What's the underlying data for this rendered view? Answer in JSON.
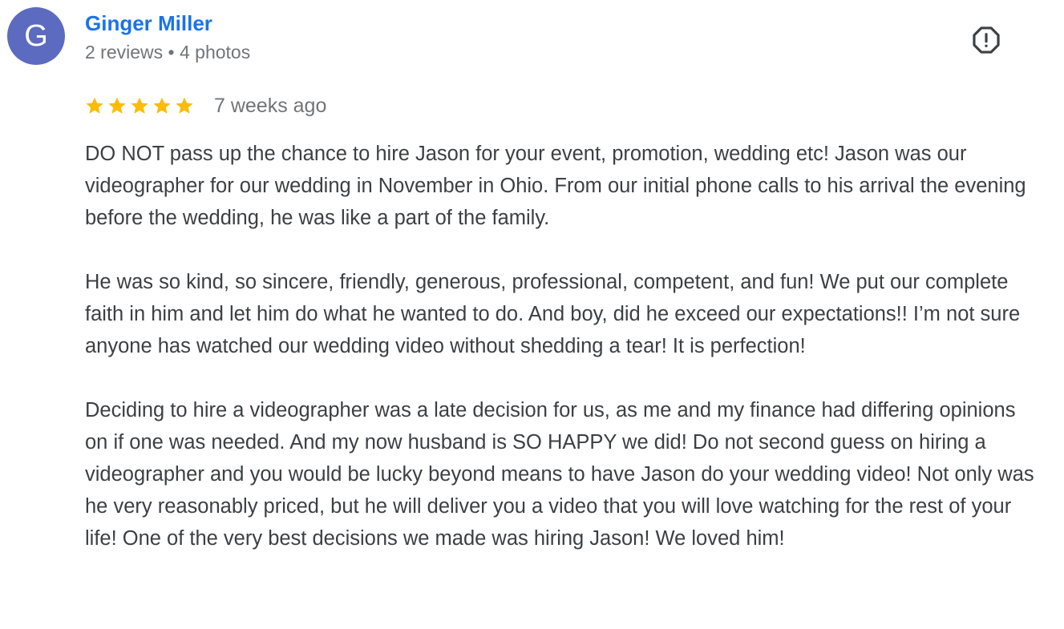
{
  "reviewer": {
    "avatar_letter": "G",
    "avatar_color": "#5c6bc0",
    "name": "Ginger Miller",
    "name_color": "#1a73e8",
    "meta": "2 reviews • 4 photos"
  },
  "report_icon": "report-flag-icon",
  "review": {
    "rating": 5,
    "max_rating": 5,
    "star_color": "#fbbc04",
    "date": "7 weeks ago",
    "paragraphs": [
      "DO NOT pass up the chance to hire Jason for your event, promotion, wedding etc! Jason was our videographer for our wedding in November in Ohio. From our initial phone calls to his arrival the evening before the wedding, he was like a part of the family.",
      "He was so kind, so sincere, friendly, generous, professional, competent, and fun! We put our complete faith in him and let him do what he wanted to do. And boy, did he exceed our expectations!! I’m not sure anyone has watched our wedding video without shedding a tear! It is perfection!",
      "Deciding to hire a videographer was a late decision for us, as me and my finance had differing opinions on if one was needed. And my now husband is SO HAPPY we did! Do not second guess on hiring a videographer and you would be lucky beyond means to have Jason do your wedding video! Not only was he very reasonably priced, but he will deliver you a video that you will love watching for the rest of your life! One of the very best decisions we made was hiring Jason! We loved him!"
    ]
  }
}
